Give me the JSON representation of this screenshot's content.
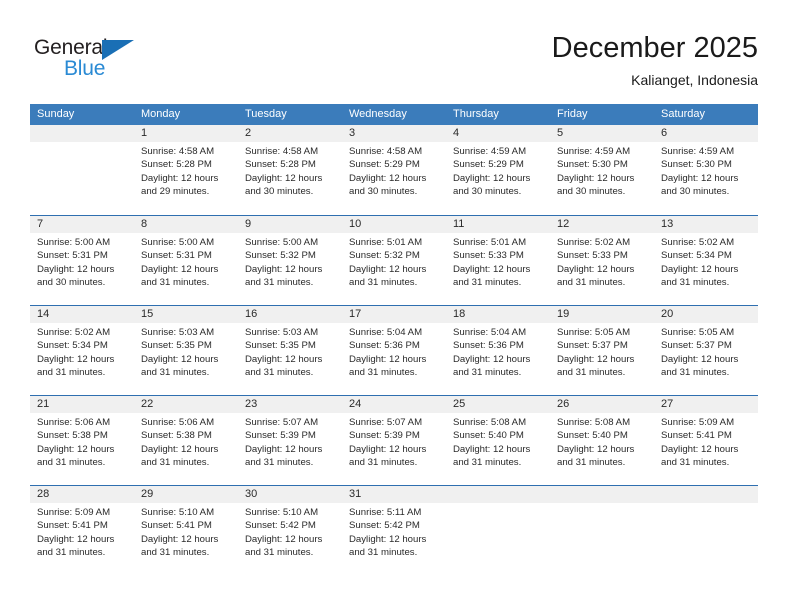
{
  "brand": {
    "name_primary": "General",
    "name_secondary": "Blue",
    "triangle_color": "#1a6fb5",
    "secondary_color": "#2a8ad4"
  },
  "header": {
    "title": "December 2025",
    "subtitle": "Kalianget, Indonesia"
  },
  "theme": {
    "header_band": "#3b7cbb",
    "row_divider": "#2f6fb0",
    "day_band": "#f0f0f0",
    "text": "#2a2a2a"
  },
  "weekdays": [
    "Sunday",
    "Monday",
    "Tuesday",
    "Wednesday",
    "Thursday",
    "Friday",
    "Saturday"
  ],
  "labels": {
    "sunrise": "Sunrise:",
    "sunset": "Sunset:",
    "daylight": "Daylight:"
  },
  "weeks": [
    [
      {
        "day": "",
        "sunrise": "",
        "sunset": "",
        "daylight": "",
        "empty": true
      },
      {
        "day": "1",
        "sunrise": "Sunrise: 4:58 AM",
        "sunset": "Sunset: 5:28 PM",
        "daylight": "Daylight: 12 hours and 29 minutes."
      },
      {
        "day": "2",
        "sunrise": "Sunrise: 4:58 AM",
        "sunset": "Sunset: 5:28 PM",
        "daylight": "Daylight: 12 hours and 30 minutes."
      },
      {
        "day": "3",
        "sunrise": "Sunrise: 4:58 AM",
        "sunset": "Sunset: 5:29 PM",
        "daylight": "Daylight: 12 hours and 30 minutes."
      },
      {
        "day": "4",
        "sunrise": "Sunrise: 4:59 AM",
        "sunset": "Sunset: 5:29 PM",
        "daylight": "Daylight: 12 hours and 30 minutes."
      },
      {
        "day": "5",
        "sunrise": "Sunrise: 4:59 AM",
        "sunset": "Sunset: 5:30 PM",
        "daylight": "Daylight: 12 hours and 30 minutes."
      },
      {
        "day": "6",
        "sunrise": "Sunrise: 4:59 AM",
        "sunset": "Sunset: 5:30 PM",
        "daylight": "Daylight: 12 hours and 30 minutes."
      }
    ],
    [
      {
        "day": "7",
        "sunrise": "Sunrise: 5:00 AM",
        "sunset": "Sunset: 5:31 PM",
        "daylight": "Daylight: 12 hours and 30 minutes."
      },
      {
        "day": "8",
        "sunrise": "Sunrise: 5:00 AM",
        "sunset": "Sunset: 5:31 PM",
        "daylight": "Daylight: 12 hours and 31 minutes."
      },
      {
        "day": "9",
        "sunrise": "Sunrise: 5:00 AM",
        "sunset": "Sunset: 5:32 PM",
        "daylight": "Daylight: 12 hours and 31 minutes."
      },
      {
        "day": "10",
        "sunrise": "Sunrise: 5:01 AM",
        "sunset": "Sunset: 5:32 PM",
        "daylight": "Daylight: 12 hours and 31 minutes."
      },
      {
        "day": "11",
        "sunrise": "Sunrise: 5:01 AM",
        "sunset": "Sunset: 5:33 PM",
        "daylight": "Daylight: 12 hours and 31 minutes."
      },
      {
        "day": "12",
        "sunrise": "Sunrise: 5:02 AM",
        "sunset": "Sunset: 5:33 PM",
        "daylight": "Daylight: 12 hours and 31 minutes."
      },
      {
        "day": "13",
        "sunrise": "Sunrise: 5:02 AM",
        "sunset": "Sunset: 5:34 PM",
        "daylight": "Daylight: 12 hours and 31 minutes."
      }
    ],
    [
      {
        "day": "14",
        "sunrise": "Sunrise: 5:02 AM",
        "sunset": "Sunset: 5:34 PM",
        "daylight": "Daylight: 12 hours and 31 minutes."
      },
      {
        "day": "15",
        "sunrise": "Sunrise: 5:03 AM",
        "sunset": "Sunset: 5:35 PM",
        "daylight": "Daylight: 12 hours and 31 minutes."
      },
      {
        "day": "16",
        "sunrise": "Sunrise: 5:03 AM",
        "sunset": "Sunset: 5:35 PM",
        "daylight": "Daylight: 12 hours and 31 minutes."
      },
      {
        "day": "17",
        "sunrise": "Sunrise: 5:04 AM",
        "sunset": "Sunset: 5:36 PM",
        "daylight": "Daylight: 12 hours and 31 minutes."
      },
      {
        "day": "18",
        "sunrise": "Sunrise: 5:04 AM",
        "sunset": "Sunset: 5:36 PM",
        "daylight": "Daylight: 12 hours and 31 minutes."
      },
      {
        "day": "19",
        "sunrise": "Sunrise: 5:05 AM",
        "sunset": "Sunset: 5:37 PM",
        "daylight": "Daylight: 12 hours and 31 minutes."
      },
      {
        "day": "20",
        "sunrise": "Sunrise: 5:05 AM",
        "sunset": "Sunset: 5:37 PM",
        "daylight": "Daylight: 12 hours and 31 minutes."
      }
    ],
    [
      {
        "day": "21",
        "sunrise": "Sunrise: 5:06 AM",
        "sunset": "Sunset: 5:38 PM",
        "daylight": "Daylight: 12 hours and 31 minutes."
      },
      {
        "day": "22",
        "sunrise": "Sunrise: 5:06 AM",
        "sunset": "Sunset: 5:38 PM",
        "daylight": "Daylight: 12 hours and 31 minutes."
      },
      {
        "day": "23",
        "sunrise": "Sunrise: 5:07 AM",
        "sunset": "Sunset: 5:39 PM",
        "daylight": "Daylight: 12 hours and 31 minutes."
      },
      {
        "day": "24",
        "sunrise": "Sunrise: 5:07 AM",
        "sunset": "Sunset: 5:39 PM",
        "daylight": "Daylight: 12 hours and 31 minutes."
      },
      {
        "day": "25",
        "sunrise": "Sunrise: 5:08 AM",
        "sunset": "Sunset: 5:40 PM",
        "daylight": "Daylight: 12 hours and 31 minutes."
      },
      {
        "day": "26",
        "sunrise": "Sunrise: 5:08 AM",
        "sunset": "Sunset: 5:40 PM",
        "daylight": "Daylight: 12 hours and 31 minutes."
      },
      {
        "day": "27",
        "sunrise": "Sunrise: 5:09 AM",
        "sunset": "Sunset: 5:41 PM",
        "daylight": "Daylight: 12 hours and 31 minutes."
      }
    ],
    [
      {
        "day": "28",
        "sunrise": "Sunrise: 5:09 AM",
        "sunset": "Sunset: 5:41 PM",
        "daylight": "Daylight: 12 hours and 31 minutes."
      },
      {
        "day": "29",
        "sunrise": "Sunrise: 5:10 AM",
        "sunset": "Sunset: 5:41 PM",
        "daylight": "Daylight: 12 hours and 31 minutes."
      },
      {
        "day": "30",
        "sunrise": "Sunrise: 5:10 AM",
        "sunset": "Sunset: 5:42 PM",
        "daylight": "Daylight: 12 hours and 31 minutes."
      },
      {
        "day": "31",
        "sunrise": "Sunrise: 5:11 AM",
        "sunset": "Sunset: 5:42 PM",
        "daylight": "Daylight: 12 hours and 31 minutes."
      },
      {
        "day": "",
        "sunrise": "",
        "sunset": "",
        "daylight": "",
        "empty": true
      },
      {
        "day": "",
        "sunrise": "",
        "sunset": "",
        "daylight": "",
        "empty": true
      },
      {
        "day": "",
        "sunrise": "",
        "sunset": "",
        "daylight": "",
        "empty": true
      }
    ]
  ]
}
